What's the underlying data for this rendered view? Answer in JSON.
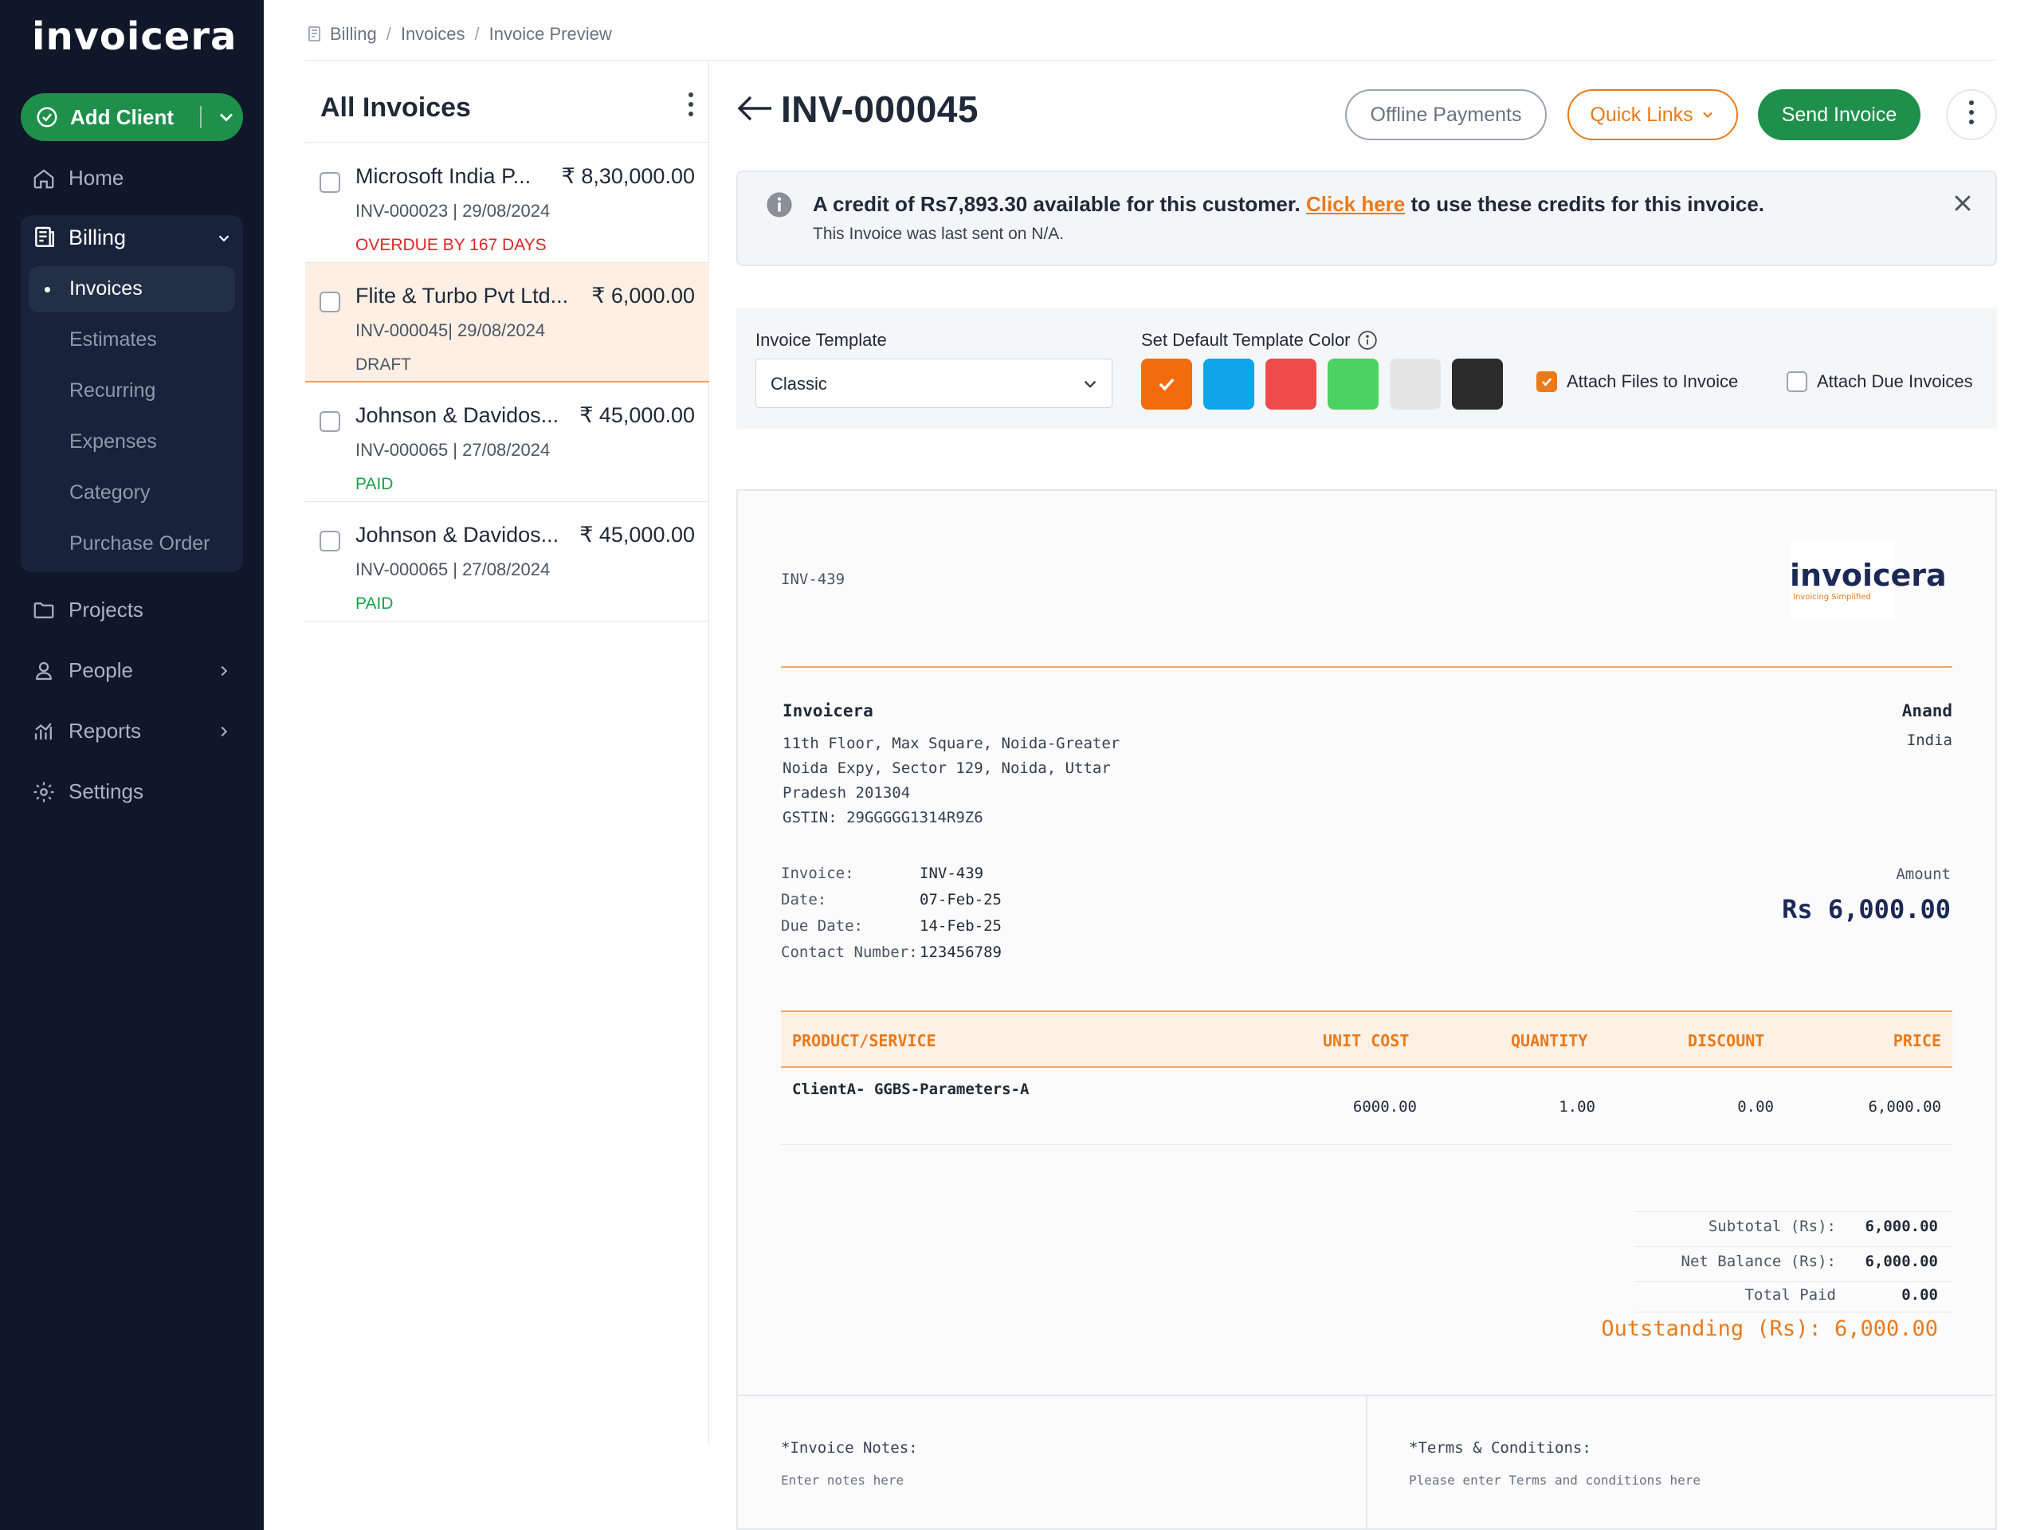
{
  "sidebar": {
    "logo": "invoicera",
    "add_client": "Add Client",
    "nav": {
      "home": "Home",
      "billing": "Billing",
      "projects": "Projects",
      "people": "People",
      "reports": "Reports",
      "settings": "Settings"
    },
    "billing_items": [
      "Invoices",
      "Estimates",
      "Recurring",
      "Expenses",
      "Category",
      "Purchase Order"
    ]
  },
  "breadcrumb": [
    "Billing",
    "Invoices",
    "Invoice Preview"
  ],
  "list": {
    "title": "All Invoices",
    "rows": [
      {
        "name": "Microsoft India P...",
        "amount": "₹ 8,30,000.00",
        "meta": "INV-000023 | 29/08/2024",
        "status": "OVERDUE BY 167 DAYS",
        "status_color": "#dc2626"
      },
      {
        "name": "Flite & Turbo Pvt Ltd...",
        "amount": "₹ 6,000.00",
        "meta": "INV-000045| 29/08/2024",
        "status": "DRAFT",
        "status_color": "#4b5563"
      },
      {
        "name": "Johnson & Davidos...",
        "amount": "₹ 45,000.00",
        "meta": "INV-000065 | 27/08/2024",
        "status": "PAID",
        "status_color": "#16a34a"
      },
      {
        "name": "Johnson & Davidos...",
        "amount": "₹ 45,000.00",
        "meta": "INV-000065 | 27/08/2024",
        "status": "PAID",
        "status_color": "#16a34a"
      }
    ]
  },
  "header": {
    "title": "INV-000045",
    "offline_payments": "Offline Payments",
    "quick_links": "Quick Links",
    "send_invoice": "Send Invoice"
  },
  "notice": {
    "text_before": "A credit of Rs7,893.30 available for this customer. ",
    "link": "Click here",
    "text_after": " to use these credits for this invoice.",
    "last_sent": "This Invoice was last sent on N/A."
  },
  "template": {
    "label": "Invoice Template",
    "selected": "Classic",
    "color_label": "Set Default Template Color",
    "colors": [
      "#f26c0d",
      "#0ea5e9",
      "#f04b4b",
      "#4cd263",
      "#e5e5e5",
      "#2b2b2b"
    ],
    "attach_files": "Attach Files to Invoice",
    "attach_due": "Attach Due Invoices"
  },
  "doc": {
    "number": "INV-439",
    "brand": "invoicera",
    "brand_tag": "Invoicing Simplified",
    "company": "Invoicera",
    "address": [
      "11th Floor, Max Square, Noida-Greater",
      "Noida Expy, Sector 129, Noida, Uttar",
      "Pradesh 201304",
      "GSTIN: 29GGGGG1314R9Z6"
    ],
    "bill_to": "Anand",
    "bill_country": "India",
    "meta_labels": [
      "Invoice:",
      "Date:",
      "Due Date:",
      "Contact Number:"
    ],
    "meta_values": [
      "INV-439",
      "07-Feb-25",
      "14-Feb-25",
      "123456789"
    ],
    "amount_label": "Amount",
    "amount": "Rs 6,000.00",
    "columns": [
      "PRODUCT/SERVICE",
      "UNIT COST",
      "QUANTITY",
      "DISCOUNT",
      "PRICE"
    ],
    "item": {
      "name": "ClientA- GGBS-Parameters-A",
      "unit_cost": "6000.00",
      "quantity": "1.00",
      "discount": "0.00",
      "price": "6,000.00"
    },
    "subtotal_label": "Subtotal (Rs):",
    "subtotal": "6,000.00",
    "net_label": "Net Balance (Rs):",
    "net": "6,000.00",
    "paid_label": "Total Paid",
    "paid": "0.00",
    "outstanding": "Outstanding (Rs): 6,000.00",
    "notes_label": "*Invoice Notes:",
    "notes_placeholder": "Enter notes here",
    "terms_label": "*Terms & Conditions:",
    "terms_placeholder": "Please enter Terms and conditions here"
  }
}
